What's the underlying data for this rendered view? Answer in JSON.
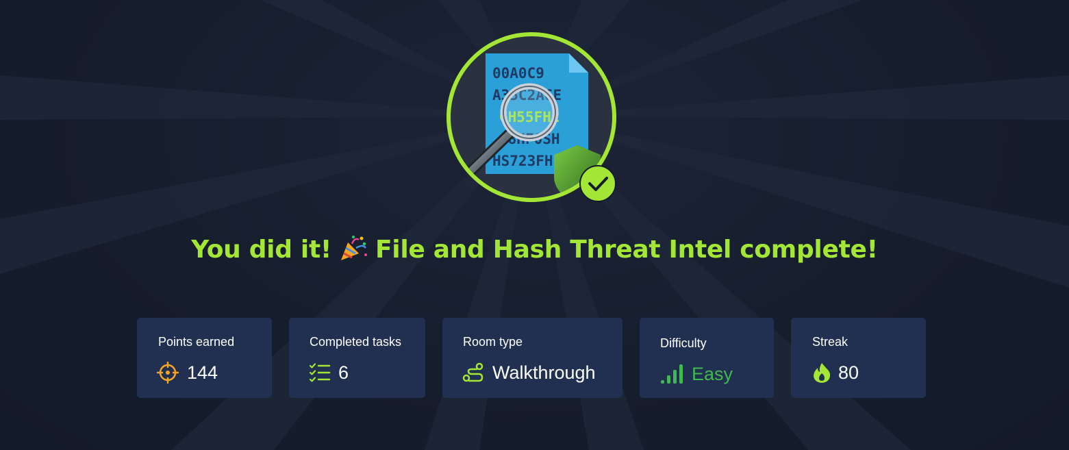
{
  "headline": {
    "prefix": "You did it!",
    "suffix": "File and Hash Threat Intel complete!",
    "emoji_icon": "party-popper-icon"
  },
  "badge": {
    "hash_lines": [
      "00A0C9",
      "A35C2A6E",
      "GH55FH2",
      "J8HF0SH",
      "HS723FH"
    ],
    "icons": [
      "document-icon",
      "magnifier-icon",
      "shield-icon",
      "checkmark-icon"
    ]
  },
  "stats": [
    {
      "label": "Points earned",
      "value": "144",
      "icon": "target-icon",
      "value_color": "#ffffff"
    },
    {
      "label": "Completed tasks",
      "value": "6",
      "icon": "checklist-icon",
      "value_color": "#ffffff"
    },
    {
      "label": "Room type",
      "value": "Walkthrough",
      "icon": "route-icon",
      "value_color": "#ffffff"
    },
    {
      "label": "Difficulty",
      "value": "Easy",
      "icon": "signal-bars-icon",
      "value_color": "#3fb950"
    },
    {
      "label": "Streak",
      "value": "80",
      "icon": "flame-icon",
      "value_color": "#ffffff"
    }
  ],
  "colors": {
    "accent": "#a3e635",
    "card_bg": "#213050",
    "page_bg": "#141b2b",
    "target_orange": "#f5a623",
    "easy_green": "#3fb950"
  }
}
